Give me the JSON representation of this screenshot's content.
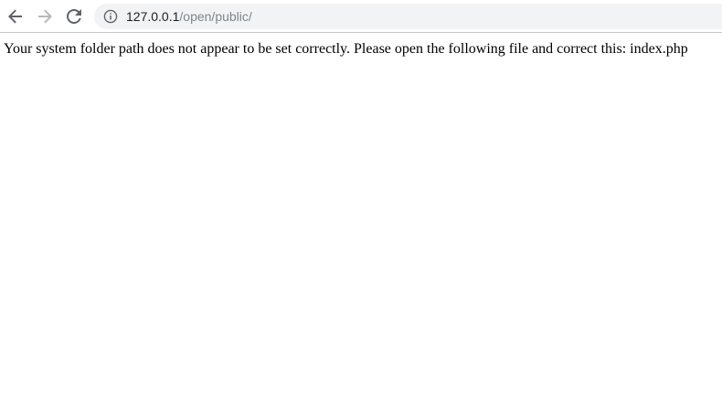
{
  "browser": {
    "icons": {
      "back": "arrow-left-icon",
      "forward": "arrow-right-icon",
      "reload": "reload-icon",
      "site_info": "info-icon"
    },
    "address_bar": {
      "host": "127.0.0.1",
      "path": "/open/public/"
    }
  },
  "page": {
    "message": "Your system folder path does not appear to be set correctly. Please open the following file and correct this: index.php"
  },
  "colors": {
    "omnibox_bg": "#f1f3f4",
    "icon_active": "#5f6368",
    "icon_disabled": "#b8b8b8",
    "url_path": "#80868b"
  }
}
